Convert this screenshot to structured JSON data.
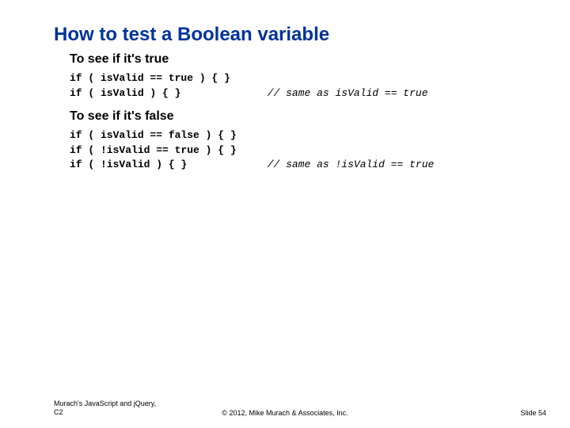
{
  "title": "How to test a Boolean variable",
  "sections": [
    {
      "heading": "To see if it's true",
      "lines": [
        {
          "code": "if ( isValid == true ) { }",
          "pad": 0,
          "comment": ""
        },
        {
          "code": "if ( isValid ) { }",
          "pad": 9,
          "comment": "// same as isValid == true"
        }
      ]
    },
    {
      "heading": "To see if it's false",
      "lines": [
        {
          "code": "if ( isValid == false ) { }",
          "pad": 0,
          "comment": ""
        },
        {
          "code": "if ( !isValid == true ) { }",
          "pad": 0,
          "comment": ""
        },
        {
          "code": "if ( !isValid ) { }",
          "pad": 8,
          "comment": "// same as !isValid == true"
        }
      ]
    }
  ],
  "footer": {
    "left_line1": "Murach's JavaScript and jQuery,",
    "left_line2": "C2",
    "center": "© 2012, Mike Murach & Associates, Inc.",
    "right": "Slide 54"
  }
}
